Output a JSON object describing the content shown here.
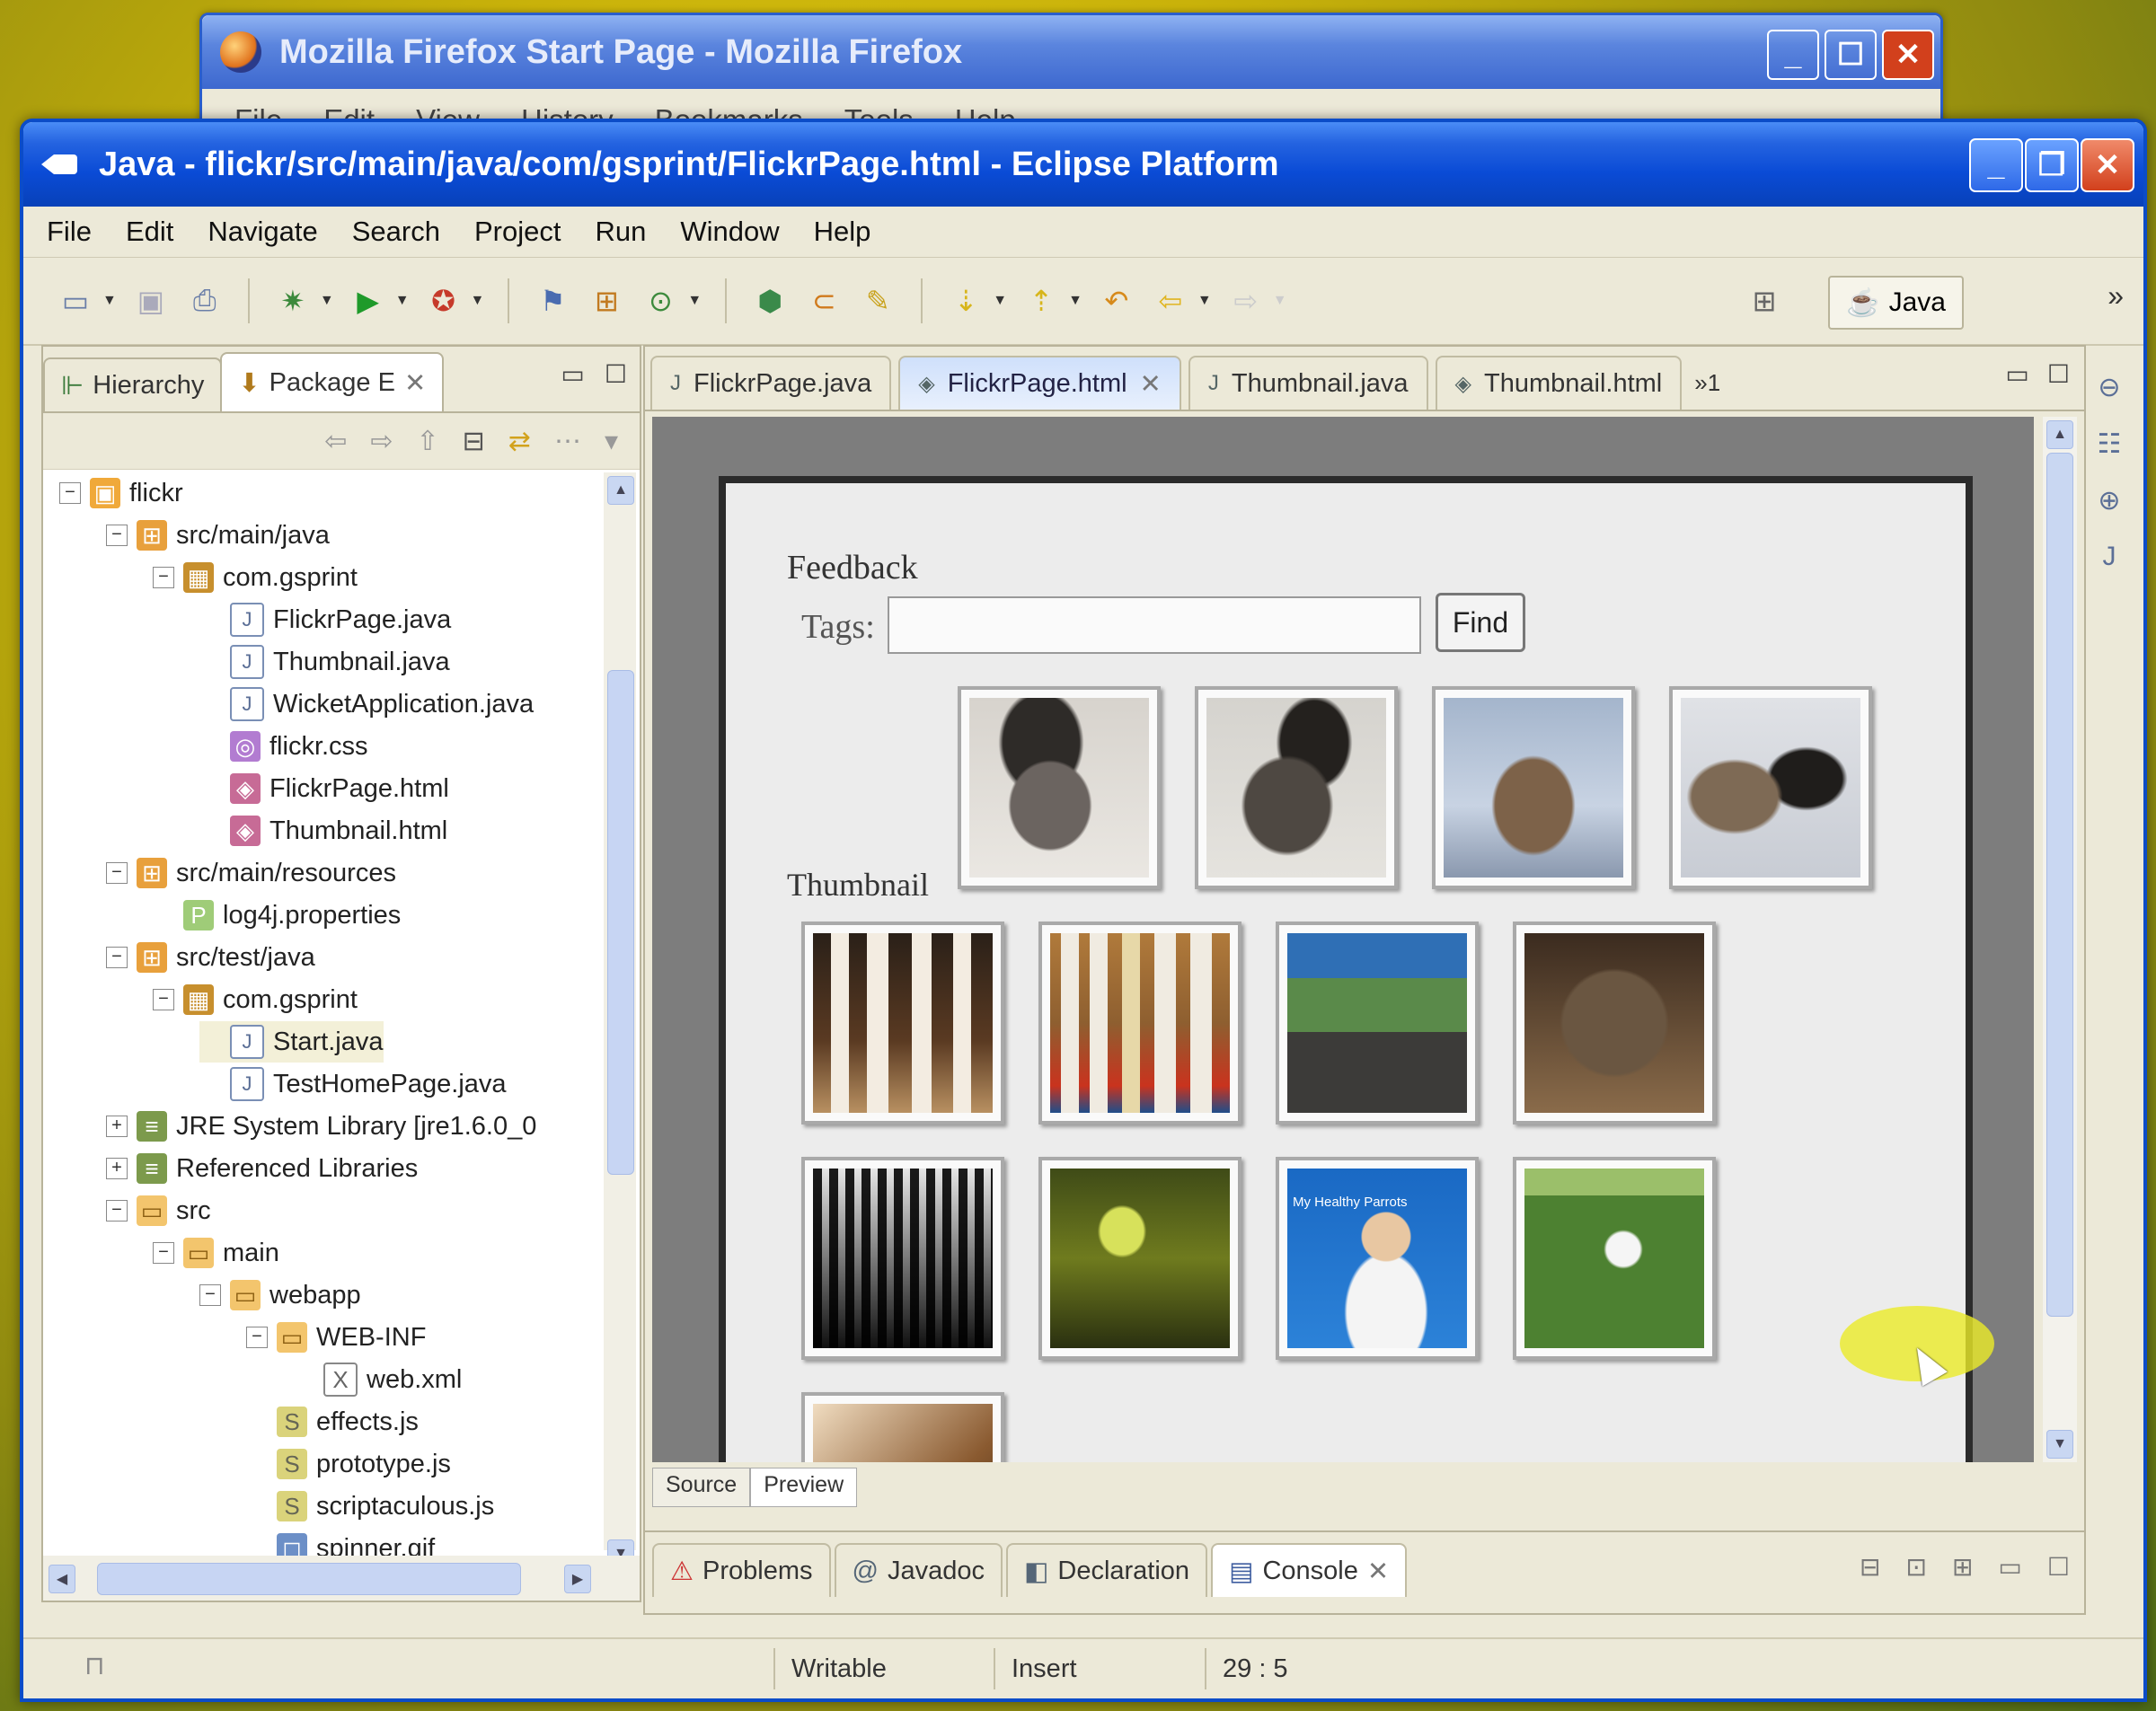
{
  "firefox": {
    "title": "Mozilla Firefox Start Page - Mozilla Firefox",
    "menu": [
      "File",
      "Edit",
      "View",
      "History",
      "Bookmarks",
      "Tools",
      "Help"
    ]
  },
  "eclipse": {
    "title": "Java - flickr/src/main/java/com/gsprint/FlickrPage.html - Eclipse Platform",
    "menu": [
      "File",
      "Edit",
      "Navigate",
      "Search",
      "Project",
      "Run",
      "Window",
      "Help"
    ],
    "perspective": "Java",
    "left_tabs": [
      "Hierarchy",
      "Package E"
    ],
    "tree": [
      {
        "label": "flickr",
        "icon": "project-icon",
        "level": 0
      },
      {
        "label": "src/main/java",
        "icon": "source-folder-icon",
        "level": 1
      },
      {
        "label": "com.gsprint",
        "icon": "package-icon",
        "level": 2
      },
      {
        "label": "FlickrPage.java",
        "icon": "java-file-icon",
        "level": 3
      },
      {
        "label": "Thumbnail.java",
        "icon": "java-file-icon",
        "level": 3
      },
      {
        "label": "WicketApplication.java",
        "icon": "java-file-icon",
        "level": 3
      },
      {
        "label": "flickr.css",
        "icon": "css-file-icon",
        "level": 3
      },
      {
        "label": "FlickrPage.html",
        "icon": "html-file-icon",
        "level": 3
      },
      {
        "label": "Thumbnail.html",
        "icon": "html-file-icon",
        "level": 3
      },
      {
        "label": "src/main/resources",
        "icon": "source-folder-icon",
        "level": 1
      },
      {
        "label": "log4j.properties",
        "icon": "properties-file-icon",
        "level": 2
      },
      {
        "label": "src/test/java",
        "icon": "source-folder-icon",
        "level": 1
      },
      {
        "label": "com.gsprint",
        "icon": "package-icon",
        "level": 2
      },
      {
        "label": "Start.java",
        "icon": "java-file-icon",
        "level": 3
      },
      {
        "label": "TestHomePage.java",
        "icon": "java-file-icon",
        "level": 3
      },
      {
        "label": "JRE System Library [jre1.6.0_0",
        "icon": "library-icon",
        "level": 1
      },
      {
        "label": "Referenced Libraries",
        "icon": "library-icon",
        "level": 1
      },
      {
        "label": "src",
        "icon": "folder-icon",
        "level": 1
      },
      {
        "label": "main",
        "icon": "folder-icon",
        "level": 2
      },
      {
        "label": "webapp",
        "icon": "folder-icon",
        "level": 3
      },
      {
        "label": "WEB-INF",
        "icon": "folder-icon",
        "level": 4
      },
      {
        "label": "web.xml",
        "icon": "xml-file-icon",
        "level": 5
      },
      {
        "label": "effects.js",
        "icon": "js-file-icon",
        "level": 4
      },
      {
        "label": "prototype.js",
        "icon": "js-file-icon",
        "level": 4
      },
      {
        "label": "scriptaculous.js",
        "icon": "js-file-icon",
        "level": 4
      },
      {
        "label": "spinner.gif",
        "icon": "gif-file-icon",
        "level": 4
      }
    ],
    "editor_tabs": [
      {
        "label": "FlickrPage.java",
        "active": false
      },
      {
        "label": "FlickrPage.html",
        "active": true
      },
      {
        "label": "Thumbnail.java",
        "active": false
      },
      {
        "label": "Thumbnail.html",
        "active": false
      }
    ],
    "editor_overflow": "»1",
    "preview": {
      "feedback_label": "Feedback",
      "tags_label": "Tags:",
      "tags_value": "",
      "find_label": "Find",
      "thumbnail_label": "Thumbnail",
      "poster_text": "My Healthy Parrots"
    },
    "editor_subtabs": [
      "Source",
      "Preview"
    ],
    "bottom_tabs": [
      "Problems",
      "Javadoc",
      "Declaration",
      "Console"
    ],
    "status": {
      "writable": "Writable",
      "insert": "Insert",
      "position": "29 : 5"
    }
  }
}
